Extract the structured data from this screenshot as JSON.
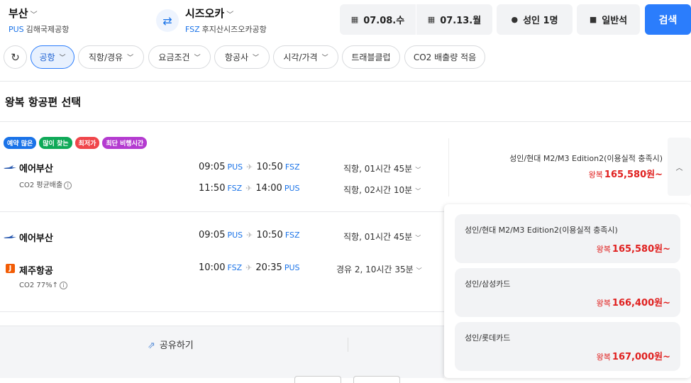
{
  "search": {
    "origin": {
      "city": "부산",
      "code": "PUS",
      "airport": "김해국제공항"
    },
    "destination": {
      "city": "시즈오카",
      "code": "FSZ",
      "airport": "후지산시즈오카공항"
    },
    "depart_date": "07.08.수",
    "return_date": "07.13.월",
    "passengers": "성인 1명",
    "cabin": "일반석",
    "search_label": "검색"
  },
  "filters": [
    {
      "label": "공항",
      "active": true
    },
    {
      "label": "직항/경유"
    },
    {
      "label": "요금조건"
    },
    {
      "label": "항공사"
    },
    {
      "label": "시각/가격"
    },
    {
      "label": "트래블클럽"
    },
    {
      "label": "CO2 배출량 적음"
    }
  ],
  "section_title": "왕복 항공편 선택",
  "badges": [
    {
      "label": "예약 많은",
      "color": "#1a73e8"
    },
    {
      "label": "많이 찾는",
      "color": "#0fa958"
    },
    {
      "label": "최저가",
      "color": "#f0464b"
    },
    {
      "label": "최단 비행시간",
      "color": "#b43bd0"
    }
  ],
  "results": [
    {
      "airline": "에어부산",
      "co2": "CO2 평균배출",
      "outbound": {
        "dep": "09:05",
        "dep_code": "PUS",
        "arr": "10:50",
        "arr_code": "FSZ",
        "duration": "직항, 01시간 45분"
      },
      "inbound": {
        "dep": "11:50",
        "dep_code": "FSZ",
        "arr": "14:00",
        "arr_code": "PUS",
        "duration": "직항, 02시간 10분"
      },
      "price_label": "성인/현대 M2/M3 Edition2(이용실적 충족시)",
      "price_prefix": "왕복",
      "price": "165,580원~"
    },
    {
      "airline_out": "에어부산",
      "airline_in": "제주항공",
      "co2": "CO2 77%↑",
      "outbound": {
        "dep": "09:05",
        "dep_code": "PUS",
        "arr": "10:50",
        "arr_code": "FSZ",
        "duration": "직항, 01시간 45분"
      },
      "inbound": {
        "dep": "10:00",
        "dep_code": "FSZ",
        "arr": "20:35",
        "arr_code": "PUS",
        "duration": "경유 2, 10시간 35분"
      }
    }
  ],
  "price_options": [
    {
      "label": "성인/현대 M2/M3 Edition2(이용실적 충족시)",
      "prefix": "왕복",
      "price": "165,580원~"
    },
    {
      "label": "성인/삼성카드",
      "prefix": "왕복",
      "price": "166,400원~"
    },
    {
      "label": "성인/롯데카드",
      "prefix": "왕복",
      "price": "167,000원~"
    }
  ],
  "share_label": "공유하기",
  "icons": {
    "calendar": "calendar-icon",
    "person": "person-icon",
    "seat": "seat-icon",
    "swap": "swap-icon",
    "refresh": "refresh-icon",
    "share": "share-icon",
    "plane": "plane-icon"
  }
}
